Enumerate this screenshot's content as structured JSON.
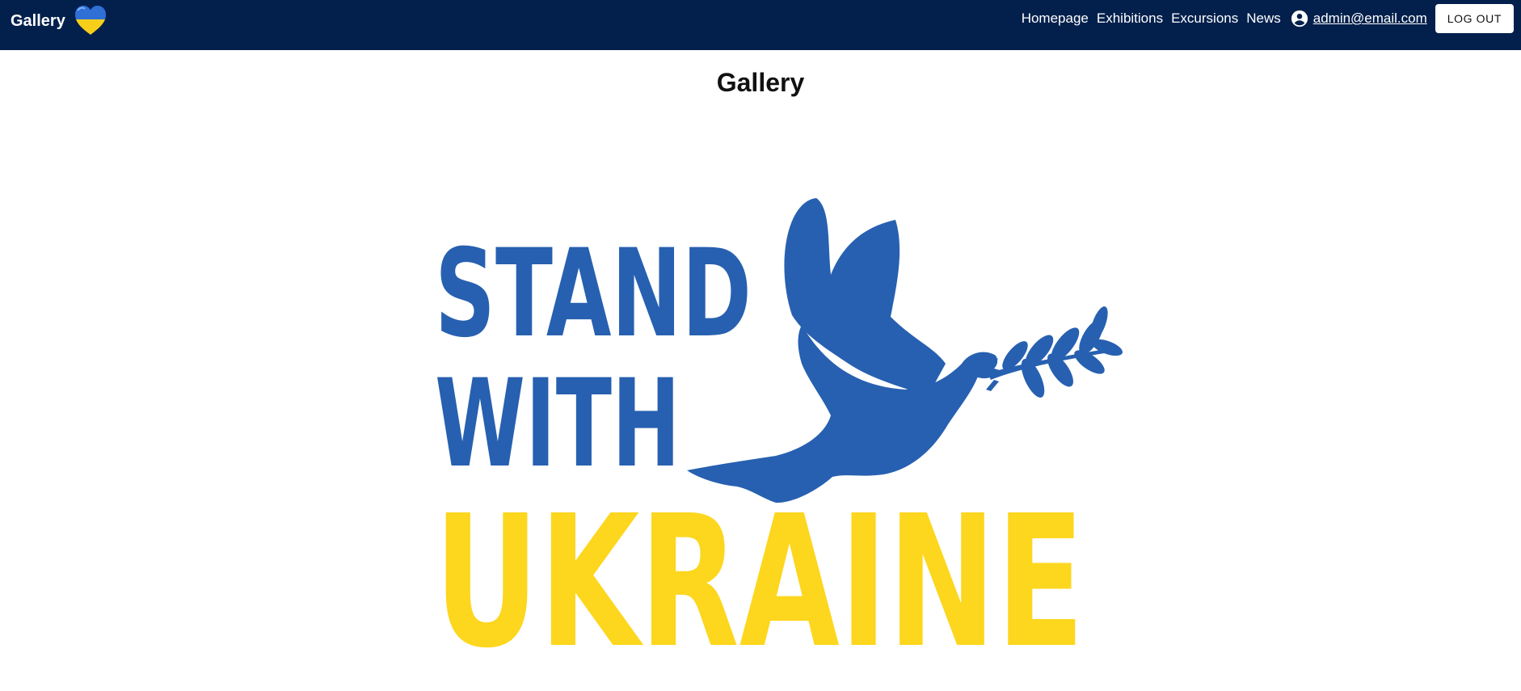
{
  "header": {
    "brand_title": "Gallery",
    "nav": {
      "homepage": "Homepage",
      "exhibitions": "Exhibitions",
      "excursions": "Excursions",
      "news": "News"
    },
    "user_email": "admin@email.com",
    "logout_label": "LOG OUT"
  },
  "main": {
    "title": "Gallery",
    "image": {
      "line1": "STAND",
      "line2": "WITH",
      "line3": "UKRAINE"
    }
  },
  "colors": {
    "appbar": "#03204c",
    "blue": "#2760b0",
    "yellow": "#fdd61e",
    "heart_blue": "#2f6fd6",
    "heart_yellow": "#f7cf1b"
  },
  "icons": {
    "brand": "heart-icon",
    "user": "account-circle-icon",
    "image": "dove-icon"
  }
}
